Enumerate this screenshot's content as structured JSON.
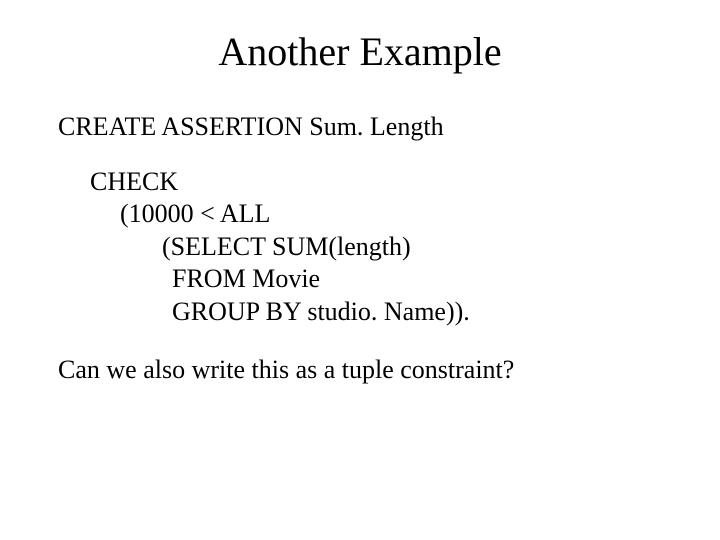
{
  "title": "Another Example",
  "statement": "CREATE ASSERTION  Sum. Length",
  "code": {
    "l1": "CHECK",
    "l2": "(10000 < ALL",
    "l3": "(SELECT  SUM(length)",
    "l4": "FROM Movie",
    "l5": "GROUP BY studio. Name))."
  },
  "question": "Can we also write this as a tuple constraint?"
}
